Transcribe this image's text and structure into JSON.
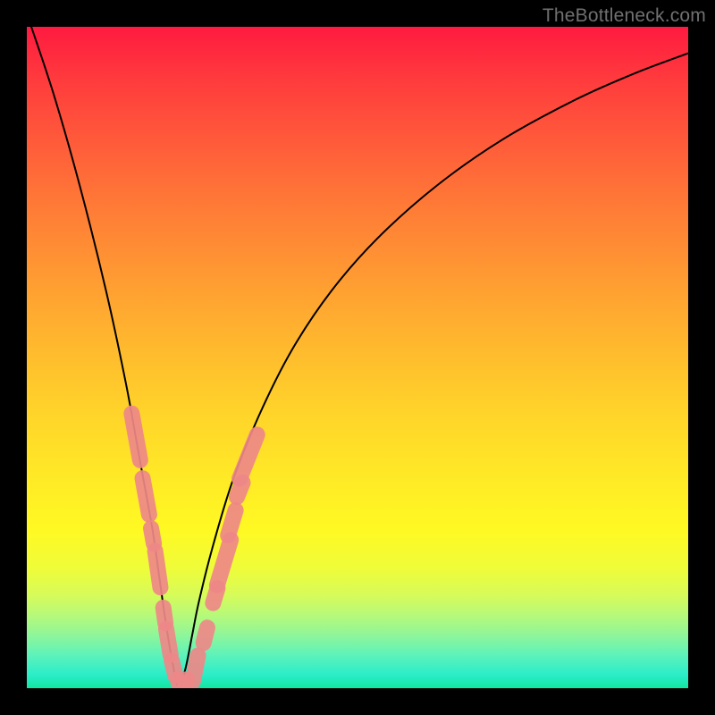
{
  "watermark": "TheBottleneck.com",
  "colors": {
    "frame": "#000000",
    "curve_stroke": "#000000",
    "marker_fill": "#ee8888",
    "marker_stroke": "#ee8888",
    "gradient_top": "#ff1a40",
    "gradient_bottom": "#12e7a0"
  },
  "chart_data": {
    "type": "line",
    "title": "",
    "xlabel": "",
    "ylabel": "",
    "xlim": [
      0,
      100
    ],
    "ylim": [
      0,
      100
    ],
    "grid": false,
    "legend": false,
    "note": "Bottleneck-style V curve. y-axis inverted visually (0 at bottom = best / green; high = worst / red). x≈23 is the optimum (curve touches 0).",
    "series": [
      {
        "name": "bottleneck-curve",
        "x": [
          0,
          4,
          8,
          12,
          15,
          17,
          19,
          20,
          21,
          22,
          23,
          24,
          25,
          26,
          28,
          31,
          35,
          40,
          46,
          53,
          62,
          72,
          83,
          92,
          100
        ],
        "y": [
          102,
          90,
          76,
          60,
          46,
          35,
          24,
          17,
          10,
          4,
          0,
          3,
          8,
          13,
          21,
          31,
          41,
          51,
          60,
          68,
          76,
          83,
          89,
          93,
          96
        ]
      }
    ],
    "markers": {
      "name": "highlighted-segments",
      "shape": "rounded-bar",
      "color": "#ee8888",
      "points": [
        {
          "x": 16.5,
          "y": 38,
          "len": 6
        },
        {
          "x": 18.0,
          "y": 29,
          "len": 5
        },
        {
          "x": 19.0,
          "y": 23,
          "len": 3
        },
        {
          "x": 19.8,
          "y": 18,
          "len": 5
        },
        {
          "x": 20.8,
          "y": 11,
          "len": 3
        },
        {
          "x": 21.4,
          "y": 7,
          "len": 4
        },
        {
          "x": 22.2,
          "y": 3,
          "len": 3
        },
        {
          "x": 23.0,
          "y": 0.6,
          "len": 2.5
        },
        {
          "x": 24.0,
          "y": 0.6,
          "len": 2.5
        },
        {
          "x": 25.5,
          "y": 3,
          "len": 4
        },
        {
          "x": 27.0,
          "y": 8,
          "len": 3
        },
        {
          "x": 28.5,
          "y": 14,
          "len": 3
        },
        {
          "x": 29.8,
          "y": 19,
          "len": 6
        },
        {
          "x": 31.0,
          "y": 25,
          "len": 4
        },
        {
          "x": 32.2,
          "y": 30,
          "len": 3
        },
        {
          "x": 33.5,
          "y": 35,
          "len": 6
        }
      ]
    }
  }
}
